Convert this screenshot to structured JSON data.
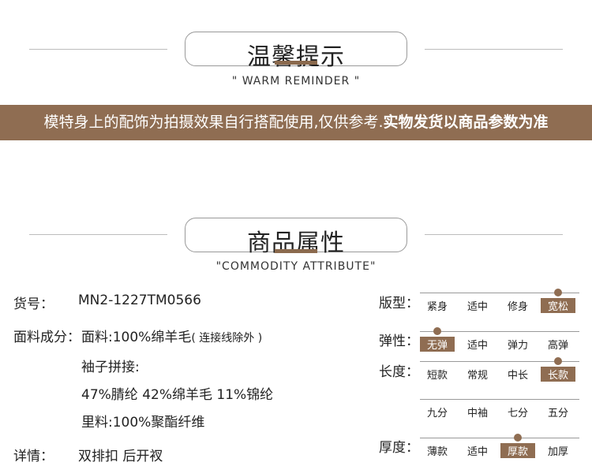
{
  "reminder": {
    "title": "温馨提示",
    "subtitle": "\" WARM REMINDER \"",
    "banner_normal": "模特身上的配饰为拍摄效果自行搭配使用,仅供参考.",
    "banner_bold": "实物发货以商品参数为准"
  },
  "attributes": {
    "title": "商品属性",
    "subtitle": "\"COMMODITY ATTRIBUTE\"",
    "item_no_label": "货号：",
    "item_no_value": "MN2-1227TM0566",
    "fabric_label": "面料成分：",
    "fabric_main": "面料:100%绵羊毛",
    "fabric_note": "( 连接线除外 )",
    "sleeve_label": "袖子拼接:",
    "sleeve_value": "47%腈纶 42%绵羊毛 11%锦纶",
    "lining": "里料:100%聚酯纤维",
    "detail_label": "详情：",
    "detail_value": "双排扣 后开衩"
  },
  "options": {
    "fit": {
      "label": "版型：",
      "items": [
        "紧身",
        "适中",
        "修身",
        "宽松"
      ],
      "selected": 3
    },
    "elasticity": {
      "label": "弹性：",
      "items": [
        "无弹",
        "适中",
        "弹力",
        "高弹"
      ],
      "selected": 0
    },
    "length": {
      "label": "长度：",
      "items": [
        "短款",
        "常规",
        "中长",
        "长款"
      ],
      "selected": 3
    },
    "sleeve_length": {
      "items": [
        "九分",
        "中袖",
        "七分",
        "五分"
      ],
      "selected": -1
    },
    "thickness": {
      "label": "厚度：",
      "items": [
        "薄款",
        "适中",
        "厚款",
        "加厚"
      ],
      "selected": 2
    }
  },
  "colors": {
    "accent": "#8f6d52",
    "line": "#999999"
  }
}
